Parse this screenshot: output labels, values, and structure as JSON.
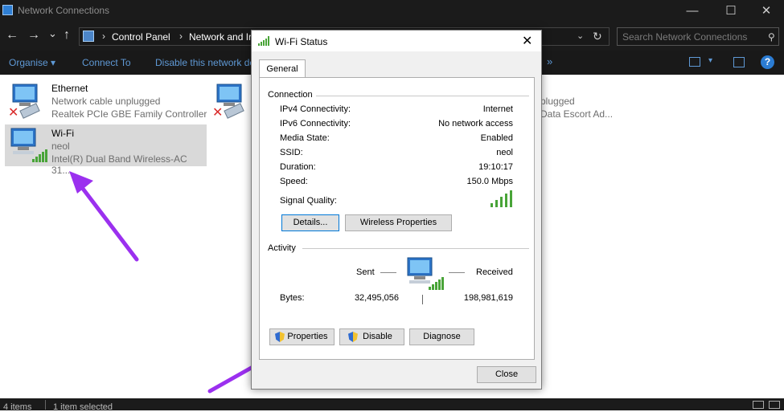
{
  "window": {
    "title": "Network Connections",
    "controls": {
      "minimize": "—",
      "maximize": "☐",
      "close": "✕"
    }
  },
  "address_bar": {
    "back": "←",
    "forward": "→",
    "recent": "⌄",
    "up": "↑",
    "crumbs": [
      "Control Panel",
      "Network and Ir"
    ],
    "refresh": "↻",
    "search_placeholder": "Search Network Connections"
  },
  "command_bar": {
    "organise": "Organise ▾",
    "connect_to": "Connect To",
    "disable": "Disable this network de",
    "more": "»"
  },
  "items": [
    {
      "name": "Ethernet",
      "line2": "Network cable unplugged",
      "line3": "Realtek PCIe GBE Family Controller",
      "status": "disconnected"
    },
    {
      "name": "",
      "line2": "plugged",
      "line3": "Data Escort Ad...",
      "status": "disconnected"
    },
    {
      "name": "Wi-Fi",
      "line2": "neol",
      "line3": "Intel(R) Dual Band Wireless-AC 31...",
      "status": "selected"
    }
  ],
  "status_bar": {
    "items": "4 items",
    "selected": "1 item selected"
  },
  "dialog": {
    "title": "Wi-Fi Status",
    "tab": "General",
    "connection": {
      "header": "Connection",
      "rows": [
        {
          "label": "IPv4 Connectivity:",
          "value": "Internet"
        },
        {
          "label": "IPv6 Connectivity:",
          "value": "No network access"
        },
        {
          "label": "Media State:",
          "value": "Enabled"
        },
        {
          "label": "SSID:",
          "value": "neol"
        },
        {
          "label": "Duration:",
          "value": "19:10:17"
        },
        {
          "label": "Speed:",
          "value": "150.0 Mbps"
        }
      ],
      "signal_label": "Signal Quality:",
      "signal_bars": 5,
      "details_button": "Details...",
      "wireless_button": "Wireless Properties"
    },
    "activity": {
      "header": "Activity",
      "sent_label": "Sent",
      "received_label": "Received",
      "bytes_label": "Bytes:",
      "sent_bytes": "32,495,056",
      "received_bytes": "198,981,619"
    },
    "buttons": {
      "properties": "Properties",
      "disable": "Disable",
      "diagnose": "Diagnose",
      "close": "Close"
    }
  },
  "colors": {
    "arrow": "#9b30ef",
    "signal": "#49a438",
    "link": "#5f99d5"
  }
}
